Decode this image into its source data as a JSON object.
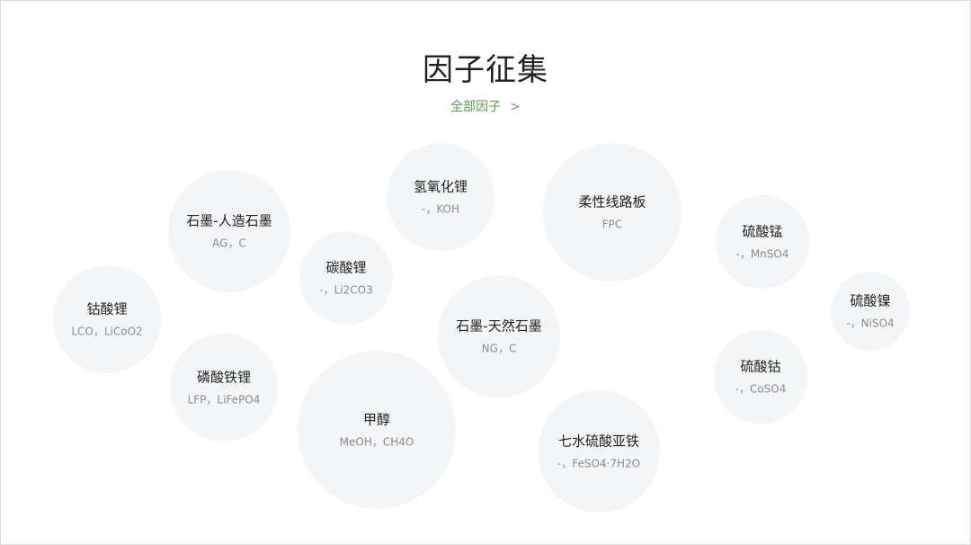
{
  "header": {
    "title": "因子征集",
    "all_link_label": "全部因子",
    "all_link_chevron": ">"
  },
  "factors": [
    {
      "id": "graphite-artificial",
      "name": "石墨-人造石墨",
      "code": "AG，C"
    },
    {
      "id": "lithium-hydroxide",
      "name": "氢氧化锂",
      "code": "-，KOH"
    },
    {
      "id": "fpc",
      "name": "柔性线路板",
      "code": "FPC"
    },
    {
      "id": "manganese-sulfate",
      "name": "硫酸锰",
      "code": "-，MnSO4"
    },
    {
      "id": "lithium-carbonate",
      "name": "碳酸锂",
      "code": "-，Li2CO3"
    },
    {
      "id": "nickel-sulfate",
      "name": "硫酸镍",
      "code": "-，NiSO4"
    },
    {
      "id": "lithium-cobalt-oxide",
      "name": "钴酸锂",
      "code": "LCO，LiCoO2"
    },
    {
      "id": "graphite-natural",
      "name": "石墨-天然石墨",
      "code": "NG，C"
    },
    {
      "id": "cobalt-sulfate",
      "name": "硫酸钴",
      "code": "-，CoSO4"
    },
    {
      "id": "lithium-iron-phosphate",
      "name": "磷酸铁锂",
      "code": "LFP，LiFePO4"
    },
    {
      "id": "methanol",
      "name": "甲醇",
      "code": "MeOH，CH4O"
    },
    {
      "id": "ferrous-sulfate-heptahydrate",
      "name": "七水硫酸亚铁",
      "code": "-，FeSO4·7H2O"
    }
  ]
}
